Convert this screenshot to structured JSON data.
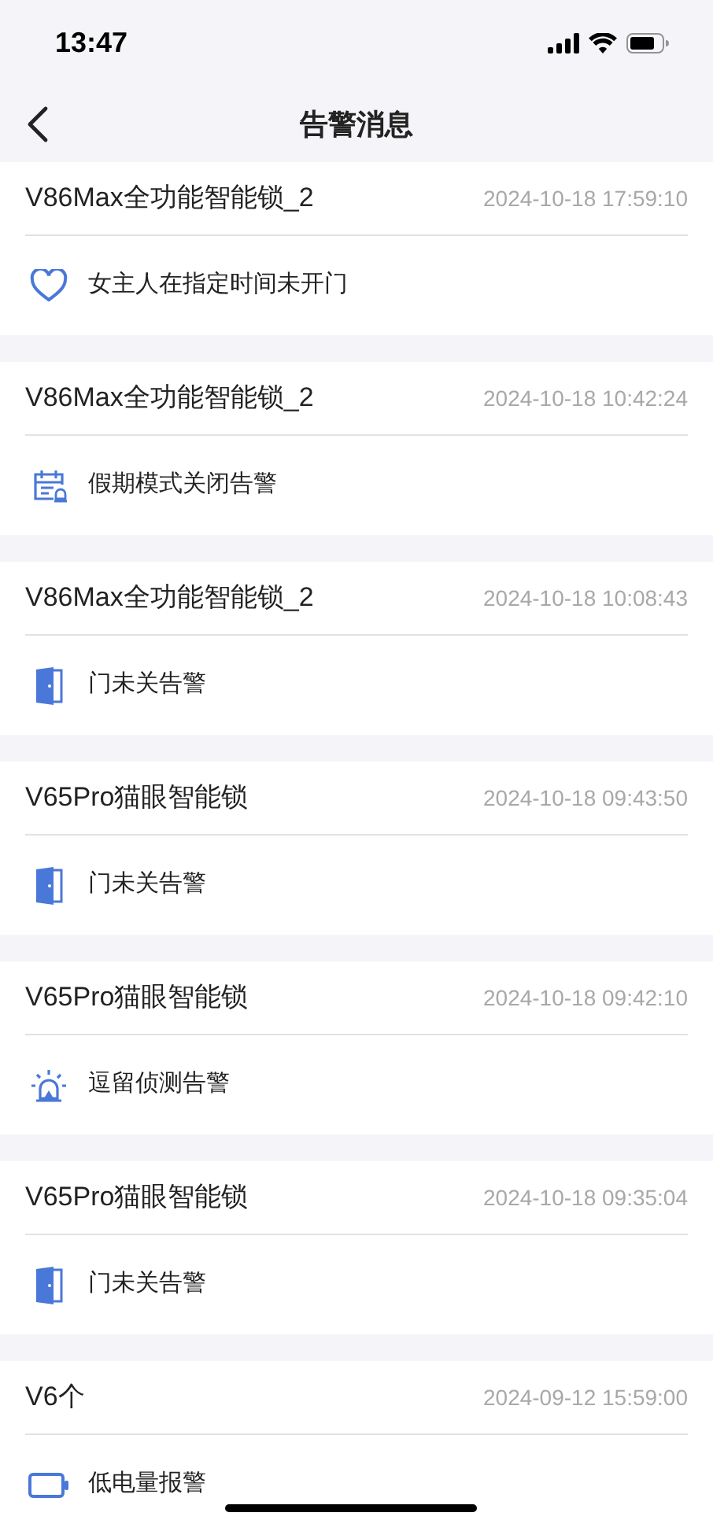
{
  "status_bar": {
    "time": "13:47"
  },
  "nav": {
    "title": "告警消息"
  },
  "alerts": [
    {
      "device": "V86Max全功能智能锁_2",
      "time": "2024-10-18 17:59:10",
      "message": "女主人在指定时间未开门",
      "kind": "heart"
    },
    {
      "device": "V86Max全功能智能锁_2",
      "time": "2024-10-18 10:42:24",
      "message": "假期模式关闭告警",
      "kind": "calendar"
    },
    {
      "device": "V86Max全功能智能锁_2",
      "time": "2024-10-18 10:08:43",
      "message": "门未关告警",
      "kind": "door"
    },
    {
      "device": "V65Pro猫眼智能锁",
      "time": "2024-10-18 09:43:50",
      "message": "门未关告警",
      "kind": "door"
    },
    {
      "device": "V65Pro猫眼智能锁",
      "time": "2024-10-18 09:42:10",
      "message": "逗留侦测告警",
      "kind": "alarm"
    },
    {
      "device": "V65Pro猫眼智能锁",
      "time": "2024-10-18 09:35:04",
      "message": "门未关告警",
      "kind": "door"
    },
    {
      "device": "V6个",
      "time": "2024-09-12 15:59:00",
      "message": "低电量报警",
      "kind": "battery"
    }
  ]
}
